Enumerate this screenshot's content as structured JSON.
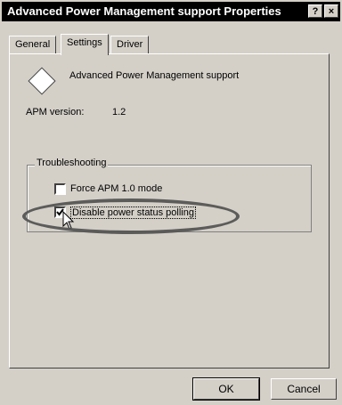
{
  "window": {
    "title": "Advanced Power Management support Properties",
    "help_glyph": "?",
    "close_glyph": "×"
  },
  "tabs": [
    {
      "label": "General"
    },
    {
      "label": "Settings",
      "active": true
    },
    {
      "label": "Driver"
    }
  ],
  "device": {
    "icon": "apm-diamond-icon",
    "name": "Advanced Power Management support",
    "version_label": "APM version:",
    "version_value": "1.2"
  },
  "troubleshooting": {
    "title": "Troubleshooting",
    "options": [
      {
        "label": "Force APM 1.0 mode",
        "checked": false
      },
      {
        "label": "Disable power status polling",
        "checked": true
      }
    ]
  },
  "buttons": {
    "ok": "OK",
    "cancel": "Cancel"
  },
  "colors": {
    "window_bg": "#d4d0c8",
    "titlebar_bg": "#000000",
    "highlight_oval": "#555555"
  }
}
